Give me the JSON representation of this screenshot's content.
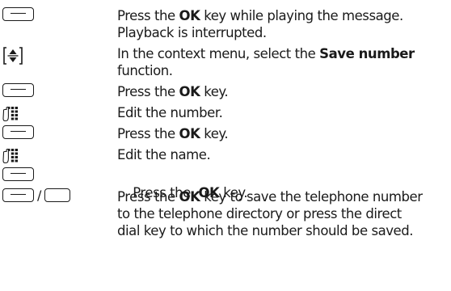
{
  "steps": [
    {
      "icon": "softkey",
      "pre": "Press the ",
      "bold": "OK",
      "post": " key while playing the message.",
      "line2": "Playback is interrupted."
    },
    {
      "icon": "navigation-key",
      "pre": "In the context menu, select the ",
      "bold": "Save number",
      "post": "",
      "line2": "function."
    },
    {
      "icon": "softkey",
      "pre": "Press the ",
      "bold": "OK",
      "post": " key."
    },
    {
      "icon": "keypad",
      "text": "Edit the number."
    },
    {
      "icon": "softkey",
      "pre": "Press the ",
      "bold": "OK",
      "post": " key."
    },
    {
      "icon": "keypad",
      "text": "Edit the name."
    },
    {
      "icon": "softkey",
      "pre": "Press the  ",
      "bold": "OK",
      "post": " key."
    },
    {
      "icon": "softkey-or-direct-dial-key",
      "separator": "/",
      "pre": "Press the ",
      "bold": "OK",
      "post": " key to save the telephone number",
      "line2": "to the telephone directory or press the direct",
      "line3": "dial key to which the number should be saved."
    }
  ]
}
